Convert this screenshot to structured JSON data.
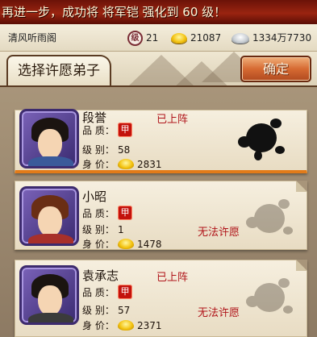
{
  "banner": {
    "text": "再进一步，成功将 将军铠 强化到 60 级！"
  },
  "status": {
    "server": "清风听雨阁",
    "level_icon_char": "级",
    "level": "21",
    "gold": "21087",
    "silver": "1334万7730"
  },
  "header": {
    "title": "选择许愿弟子",
    "confirm_label": "确定"
  },
  "labels": {
    "quality": "品 质：",
    "level": "级 别：",
    "value": "身 价："
  },
  "quality_badge": "甲",
  "disciples": [
    {
      "name": "段誉",
      "level": "58",
      "value": "2831",
      "status": "已上阵",
      "note": "",
      "selected": true
    },
    {
      "name": "小昭",
      "level": "1",
      "value": "1478",
      "status": "",
      "note": "无法许愿",
      "selected": false
    },
    {
      "name": "袁承志",
      "level": "57",
      "value": "2371",
      "status": "已上阵",
      "note": "无法许愿",
      "selected": false
    }
  ],
  "colors": {
    "banner": "#9a2410",
    "confirm": "#d66a32",
    "status_red": "#b0141a",
    "selected_accent": "#e27b19"
  }
}
